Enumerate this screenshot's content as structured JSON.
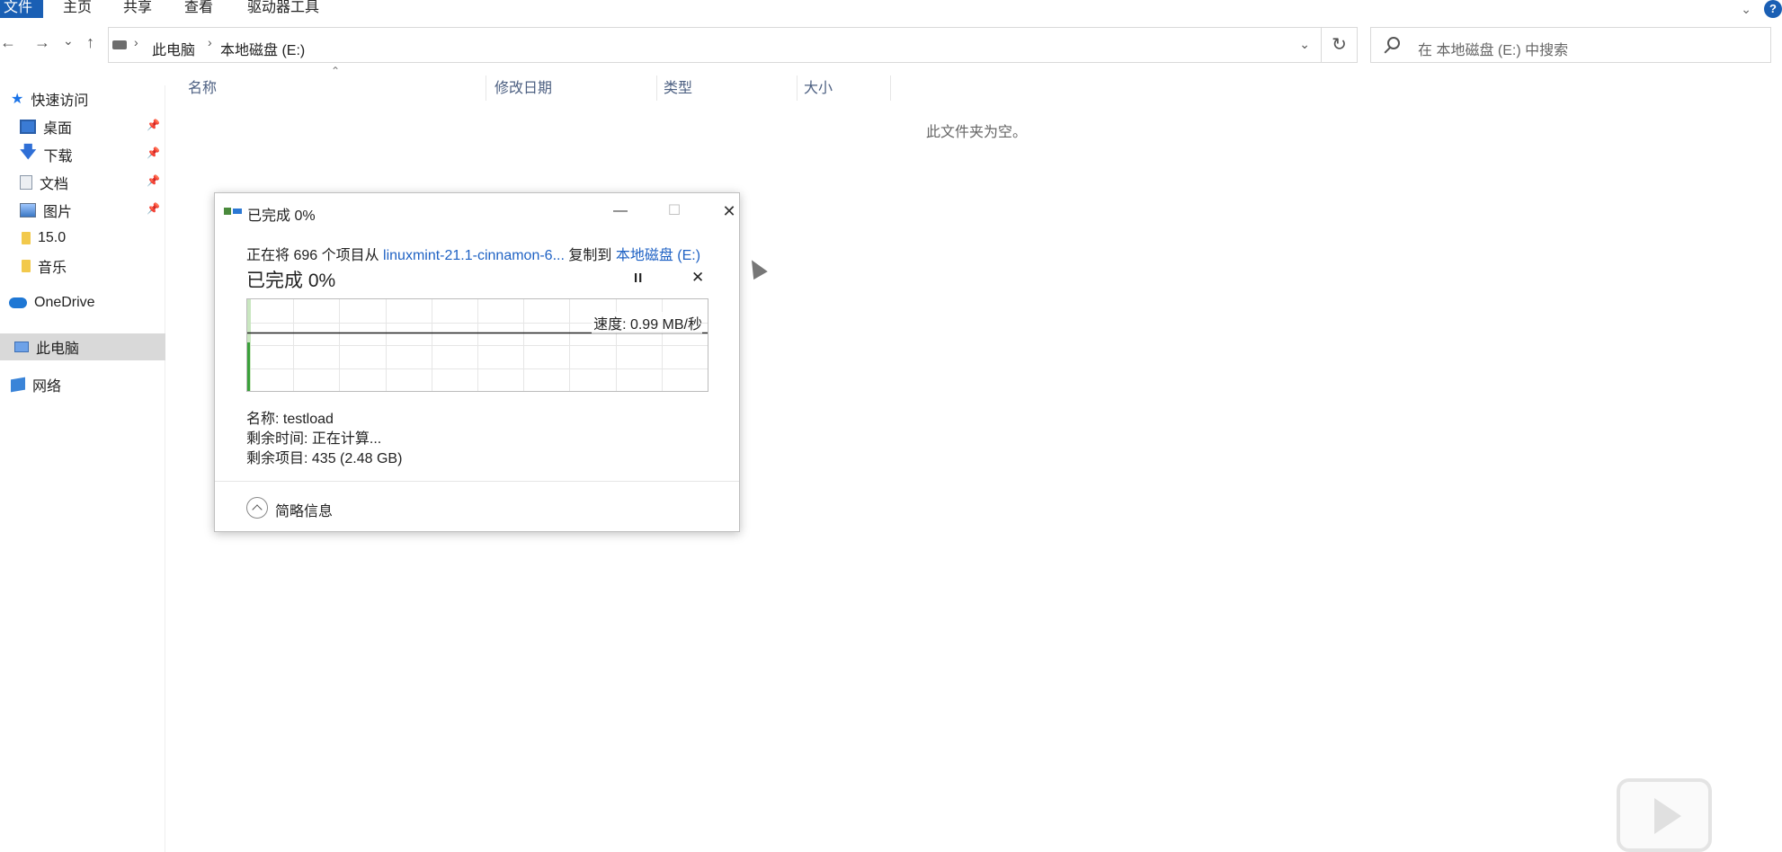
{
  "ribbon": {
    "tabs": [
      {
        "label": "文件",
        "active": true
      },
      {
        "label": "主页",
        "active": false
      },
      {
        "label": "共享",
        "active": false
      },
      {
        "label": "查看",
        "active": false
      },
      {
        "label": "驱动器工具",
        "active": false
      }
    ],
    "help_label": "?"
  },
  "nav": {
    "back": "←",
    "forward": "→",
    "recent": "⌄",
    "up": "↑",
    "breadcrumb": [
      "此电脑",
      "本地磁盘 (E:)"
    ],
    "refresh": "↻",
    "search_placeholder": "在 本地磁盘 (E:) 中搜索"
  },
  "sidebar": {
    "items": [
      {
        "label": "快速访问",
        "icon": "star-icon"
      },
      {
        "label": "桌面",
        "icon": "desktop-icon",
        "pinned": true
      },
      {
        "label": "下载",
        "icon": "download-icon",
        "pinned": true
      },
      {
        "label": "文档",
        "icon": "document-icon",
        "pinned": true
      },
      {
        "label": "图片",
        "icon": "pictures-icon",
        "pinned": true
      },
      {
        "label": "15.0",
        "icon": "folder-icon"
      },
      {
        "label": "音乐",
        "icon": "folder-icon"
      },
      {
        "label": "OneDrive",
        "icon": "cloud-icon"
      },
      {
        "label": "此电脑",
        "icon": "pc-icon",
        "selected": true
      },
      {
        "label": "网络",
        "icon": "network-icon"
      }
    ]
  },
  "columns": [
    "名称",
    "修改日期",
    "类型",
    "大小"
  ],
  "empty_message": "此文件夹为空。",
  "dialog": {
    "title": "已完成 0%",
    "copy_prefix": "正在将 696 个项目从 ",
    "source": "linuxmint-21.1-cinnamon-6...",
    "copy_mid": " 复制到 ",
    "destination": "本地磁盘 (E:)",
    "big_status": "已完成 0%",
    "pause_label": "II",
    "cancel_label": "✕",
    "speed": "速度: 0.99 MB/秒",
    "progress_fraction": 0.0,
    "name_line": "名称: testload",
    "time_left_line": "剩余时间: 正在计算...",
    "items_left_line": "剩余项目: 435 (2.48 GB)",
    "details_label": "简略信息",
    "minimize": "—",
    "maximize": "☐",
    "close": "✕"
  },
  "colors": {
    "accent": "#1a5fb4",
    "link": "#1f62c4",
    "progress": "#3aa03a"
  }
}
